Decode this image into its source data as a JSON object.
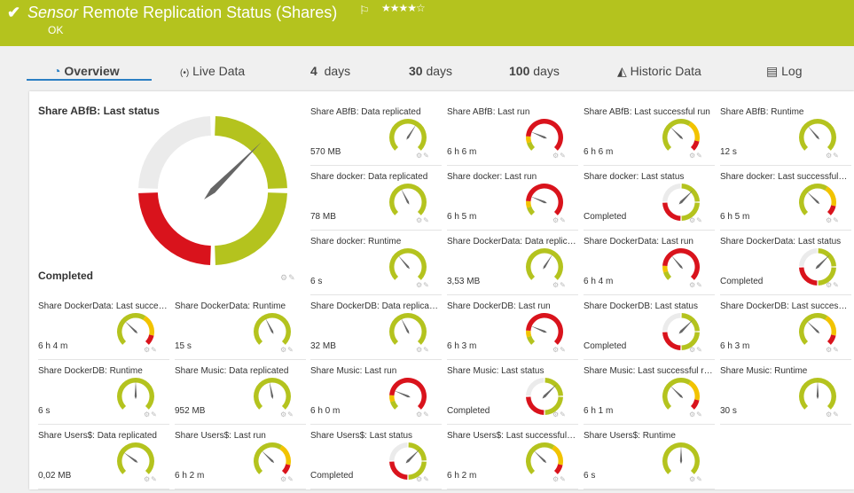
{
  "header": {
    "title_italic": "Sensor",
    "title": "Remote Replication Status (Shares)",
    "status": "OK",
    "stars": "★★★★☆",
    "flag_icon": "⚐",
    "check_icon": "✔",
    "bg_color": "#b4c31e"
  },
  "tabs": [
    {
      "label": "Overview",
      "icon": "gauge-icon",
      "glyph": "◔",
      "active": true
    },
    {
      "label": "Live Data",
      "icon": "broadcast-icon",
      "glyph": "(•)"
    },
    {
      "num": "4",
      "unit": "days"
    },
    {
      "num": "30",
      "unit": "days"
    },
    {
      "num": "100",
      "unit": "days"
    },
    {
      "label": "Historic Data",
      "icon": "area-chart-icon",
      "glyph": "◭"
    },
    {
      "label": "Log",
      "icon": "log-icon",
      "glyph": "▤"
    }
  ],
  "colors": {
    "green": "#b4c31e",
    "yellow": "#f2c300",
    "red": "#d9131c",
    "grey": "#ebebeb",
    "needle": "#666666"
  },
  "main_gauge": {
    "label": "Share ABfB: Last status",
    "value": "Completed",
    "type": "status",
    "needle_fraction": 0.8
  },
  "tiles": [
    {
      "label": "Share ABfB: Data replicated",
      "value": "570 MB",
      "type": "simple",
      "needle_fraction": 0.62
    },
    {
      "label": "Share ABfB: Last run",
      "value": "6 h 6 m",
      "type": "red",
      "needle_fraction": 0.25
    },
    {
      "label": "Share ABfB: Last successful run",
      "value": "6 h 6 m",
      "type": "limits",
      "needle_fraction": 0.33
    },
    {
      "label": "Share ABfB: Runtime",
      "value": "12 s",
      "type": "simple",
      "needle_fraction": 0.35
    },
    {
      "label": "Share docker: Data replicated",
      "value": "78 MB",
      "type": "simple",
      "needle_fraction": 0.4
    },
    {
      "label": "Share docker: Last run",
      "value": "6 h 5 m",
      "type": "red",
      "needle_fraction": 0.25
    },
    {
      "label": "Share docker: Last status",
      "value": "Completed",
      "type": "status",
      "needle_fraction": 0.8
    },
    {
      "label": "Share docker: Last successful run",
      "value": "6 h 5 m",
      "type": "limits",
      "needle_fraction": 0.33
    },
    {
      "label": "Share docker: Runtime",
      "value": "6 s",
      "type": "simple",
      "needle_fraction": 0.35
    },
    {
      "label": "Share DockerData: Data replicated",
      "value": "3,53 MB",
      "type": "simple",
      "needle_fraction": 0.62
    },
    {
      "label": "Share DockerData: Last run",
      "value": "6 h 4 m",
      "type": "red",
      "needle_fraction": 0.35
    },
    {
      "label": "Share DockerData: Last status",
      "value": "Completed",
      "type": "status",
      "needle_fraction": 0.8
    },
    {
      "label": "Share DockerData: Last successful run",
      "value": "6 h 4 m",
      "type": "limits",
      "needle_fraction": 0.33
    },
    {
      "label": "Share DockerData: Runtime",
      "value": "15 s",
      "type": "simple",
      "needle_fraction": 0.4
    },
    {
      "label": "Share DockerDB: Data replicated",
      "value": "32 MB",
      "type": "simple",
      "needle_fraction": 0.4
    },
    {
      "label": "Share DockerDB: Last run",
      "value": "6 h 3 m",
      "type": "red",
      "needle_fraction": 0.25
    },
    {
      "label": "Share DockerDB: Last status",
      "value": "Completed",
      "type": "status",
      "needle_fraction": 0.8
    },
    {
      "label": "Share DockerDB: Last successful run",
      "value": "6 h 3 m",
      "type": "limits",
      "needle_fraction": 0.33
    },
    {
      "label": "Share DockerDB: Runtime",
      "value": "6 s",
      "type": "simple",
      "needle_fraction": 0.5
    },
    {
      "label": "Share Music: Data replicated",
      "value": "952 MB",
      "type": "simple",
      "needle_fraction": 0.46
    },
    {
      "label": "Share Music: Last run",
      "value": "6 h 0 m",
      "type": "red",
      "needle_fraction": 0.25
    },
    {
      "label": "Share Music: Last status",
      "value": "Completed",
      "type": "status",
      "needle_fraction": 0.8
    },
    {
      "label": "Share Music: Last successful run",
      "value": "6 h 1 m",
      "type": "limits",
      "needle_fraction": 0.33
    },
    {
      "label": "Share Music: Runtime",
      "value": "30 s",
      "type": "simple",
      "needle_fraction": 0.5
    },
    {
      "label": "Share Users$: Data replicated",
      "value": "0,02 MB",
      "type": "simple",
      "needle_fraction": 0.3
    },
    {
      "label": "Share Users$: Last run",
      "value": "6 h 2 m",
      "type": "limits",
      "needle_fraction": 0.33
    },
    {
      "label": "Share Users$: Last status",
      "value": "Completed",
      "type": "status",
      "needle_fraction": 0.8
    },
    {
      "label": "Share Users$: Last successful run",
      "value": "6 h 2 m",
      "type": "limits",
      "needle_fraction": 0.33
    },
    {
      "label": "Share Users$: Runtime",
      "value": "6 s",
      "type": "simple",
      "needle_fraction": 0.5
    }
  ],
  "tile_icons": "⚙✎"
}
